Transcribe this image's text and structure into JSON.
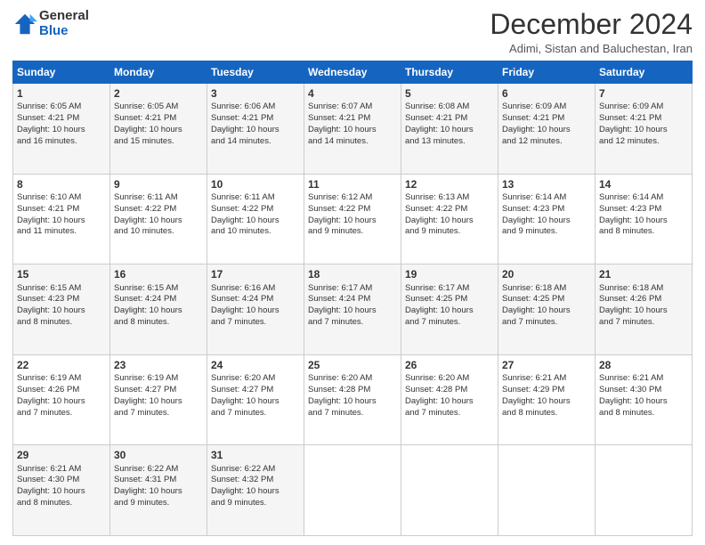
{
  "header": {
    "logo_line1": "General",
    "logo_line2": "Blue",
    "month_title": "December 2024",
    "subtitle": "Adimi, Sistan and Baluchestan, Iran"
  },
  "days_of_week": [
    "Sunday",
    "Monday",
    "Tuesday",
    "Wednesday",
    "Thursday",
    "Friday",
    "Saturday"
  ],
  "weeks": [
    [
      {
        "day": 1,
        "lines": [
          "Sunrise: 6:05 AM",
          "Sunset: 4:21 PM",
          "Daylight: 10 hours",
          "and 16 minutes."
        ]
      },
      {
        "day": 2,
        "lines": [
          "Sunrise: 6:05 AM",
          "Sunset: 4:21 PM",
          "Daylight: 10 hours",
          "and 15 minutes."
        ]
      },
      {
        "day": 3,
        "lines": [
          "Sunrise: 6:06 AM",
          "Sunset: 4:21 PM",
          "Daylight: 10 hours",
          "and 14 minutes."
        ]
      },
      {
        "day": 4,
        "lines": [
          "Sunrise: 6:07 AM",
          "Sunset: 4:21 PM",
          "Daylight: 10 hours",
          "and 14 minutes."
        ]
      },
      {
        "day": 5,
        "lines": [
          "Sunrise: 6:08 AM",
          "Sunset: 4:21 PM",
          "Daylight: 10 hours",
          "and 13 minutes."
        ]
      },
      {
        "day": 6,
        "lines": [
          "Sunrise: 6:09 AM",
          "Sunset: 4:21 PM",
          "Daylight: 10 hours",
          "and 12 minutes."
        ]
      },
      {
        "day": 7,
        "lines": [
          "Sunrise: 6:09 AM",
          "Sunset: 4:21 PM",
          "Daylight: 10 hours",
          "and 12 minutes."
        ]
      }
    ],
    [
      {
        "day": 8,
        "lines": [
          "Sunrise: 6:10 AM",
          "Sunset: 4:21 PM",
          "Daylight: 10 hours",
          "and 11 minutes."
        ]
      },
      {
        "day": 9,
        "lines": [
          "Sunrise: 6:11 AM",
          "Sunset: 4:22 PM",
          "Daylight: 10 hours",
          "and 10 minutes."
        ]
      },
      {
        "day": 10,
        "lines": [
          "Sunrise: 6:11 AM",
          "Sunset: 4:22 PM",
          "Daylight: 10 hours",
          "and 10 minutes."
        ]
      },
      {
        "day": 11,
        "lines": [
          "Sunrise: 6:12 AM",
          "Sunset: 4:22 PM",
          "Daylight: 10 hours",
          "and 9 minutes."
        ]
      },
      {
        "day": 12,
        "lines": [
          "Sunrise: 6:13 AM",
          "Sunset: 4:22 PM",
          "Daylight: 10 hours",
          "and 9 minutes."
        ]
      },
      {
        "day": 13,
        "lines": [
          "Sunrise: 6:14 AM",
          "Sunset: 4:23 PM",
          "Daylight: 10 hours",
          "and 9 minutes."
        ]
      },
      {
        "day": 14,
        "lines": [
          "Sunrise: 6:14 AM",
          "Sunset: 4:23 PM",
          "Daylight: 10 hours",
          "and 8 minutes."
        ]
      }
    ],
    [
      {
        "day": 15,
        "lines": [
          "Sunrise: 6:15 AM",
          "Sunset: 4:23 PM",
          "Daylight: 10 hours",
          "and 8 minutes."
        ]
      },
      {
        "day": 16,
        "lines": [
          "Sunrise: 6:15 AM",
          "Sunset: 4:24 PM",
          "Daylight: 10 hours",
          "and 8 minutes."
        ]
      },
      {
        "day": 17,
        "lines": [
          "Sunrise: 6:16 AM",
          "Sunset: 4:24 PM",
          "Daylight: 10 hours",
          "and 7 minutes."
        ]
      },
      {
        "day": 18,
        "lines": [
          "Sunrise: 6:17 AM",
          "Sunset: 4:24 PM",
          "Daylight: 10 hours",
          "and 7 minutes."
        ]
      },
      {
        "day": 19,
        "lines": [
          "Sunrise: 6:17 AM",
          "Sunset: 4:25 PM",
          "Daylight: 10 hours",
          "and 7 minutes."
        ]
      },
      {
        "day": 20,
        "lines": [
          "Sunrise: 6:18 AM",
          "Sunset: 4:25 PM",
          "Daylight: 10 hours",
          "and 7 minutes."
        ]
      },
      {
        "day": 21,
        "lines": [
          "Sunrise: 6:18 AM",
          "Sunset: 4:26 PM",
          "Daylight: 10 hours",
          "and 7 minutes."
        ]
      }
    ],
    [
      {
        "day": 22,
        "lines": [
          "Sunrise: 6:19 AM",
          "Sunset: 4:26 PM",
          "Daylight: 10 hours",
          "and 7 minutes."
        ]
      },
      {
        "day": 23,
        "lines": [
          "Sunrise: 6:19 AM",
          "Sunset: 4:27 PM",
          "Daylight: 10 hours",
          "and 7 minutes."
        ]
      },
      {
        "day": 24,
        "lines": [
          "Sunrise: 6:20 AM",
          "Sunset: 4:27 PM",
          "Daylight: 10 hours",
          "and 7 minutes."
        ]
      },
      {
        "day": 25,
        "lines": [
          "Sunrise: 6:20 AM",
          "Sunset: 4:28 PM",
          "Daylight: 10 hours",
          "and 7 minutes."
        ]
      },
      {
        "day": 26,
        "lines": [
          "Sunrise: 6:20 AM",
          "Sunset: 4:28 PM",
          "Daylight: 10 hours",
          "and 7 minutes."
        ]
      },
      {
        "day": 27,
        "lines": [
          "Sunrise: 6:21 AM",
          "Sunset: 4:29 PM",
          "Daylight: 10 hours",
          "and 8 minutes."
        ]
      },
      {
        "day": 28,
        "lines": [
          "Sunrise: 6:21 AM",
          "Sunset: 4:30 PM",
          "Daylight: 10 hours",
          "and 8 minutes."
        ]
      }
    ],
    [
      {
        "day": 29,
        "lines": [
          "Sunrise: 6:21 AM",
          "Sunset: 4:30 PM",
          "Daylight: 10 hours",
          "and 8 minutes."
        ]
      },
      {
        "day": 30,
        "lines": [
          "Sunrise: 6:22 AM",
          "Sunset: 4:31 PM",
          "Daylight: 10 hours",
          "and 9 minutes."
        ]
      },
      {
        "day": 31,
        "lines": [
          "Sunrise: 6:22 AM",
          "Sunset: 4:32 PM",
          "Daylight: 10 hours",
          "and 9 minutes."
        ]
      },
      null,
      null,
      null,
      null
    ]
  ]
}
